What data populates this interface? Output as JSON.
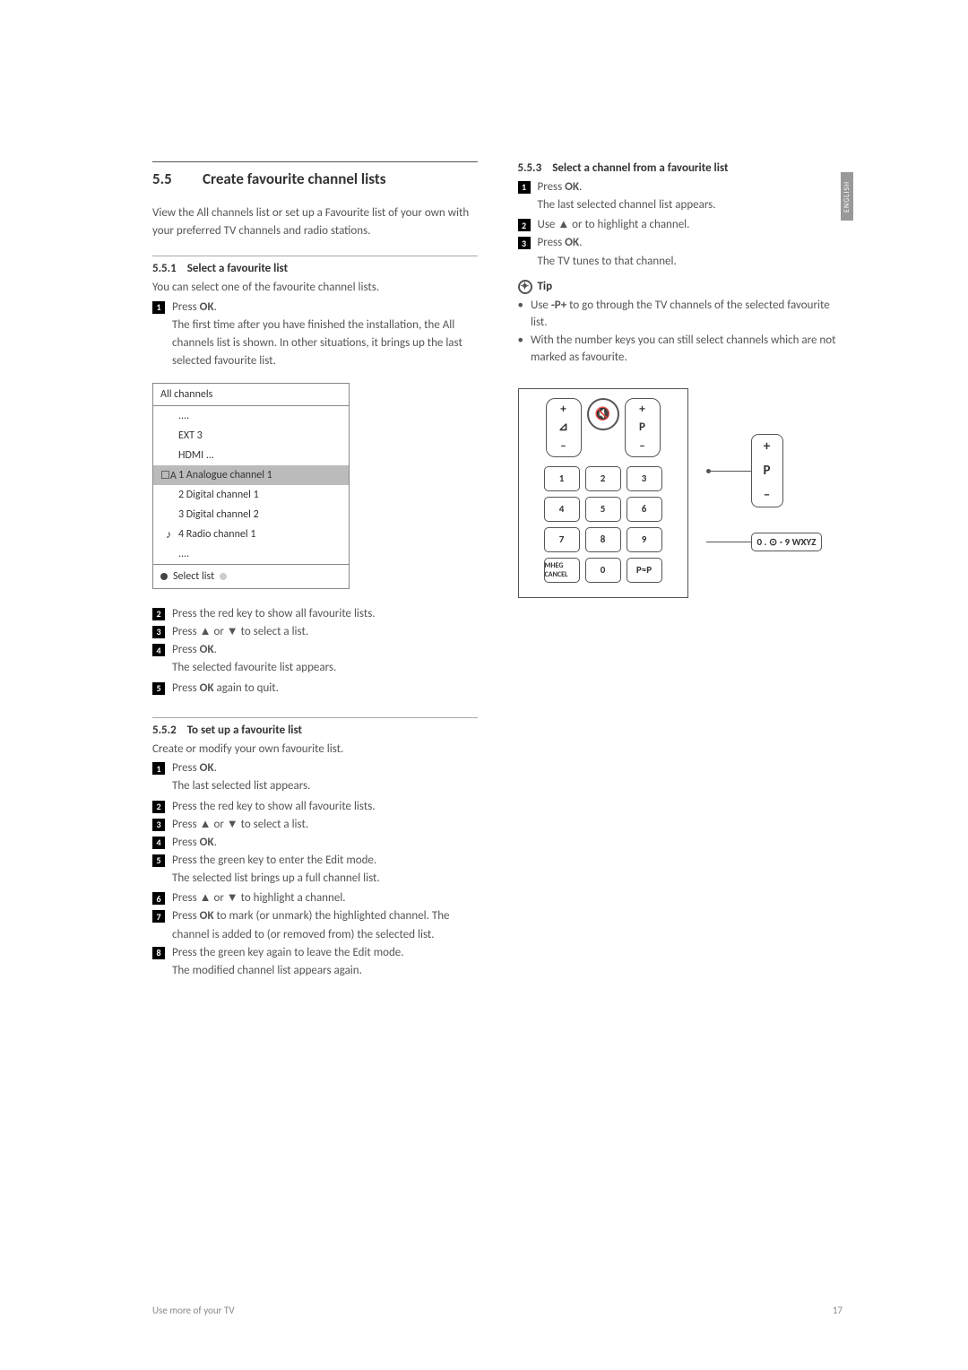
{
  "tab": "ENGLISH",
  "section": {
    "num": "5.5",
    "title": "Create favourite channel lists"
  },
  "intro": "View the All channels list or set up a Favourite list of your own with your preferred TV channels and radio stations.",
  "s551": {
    "num": "5.5.1",
    "title": "Select a favourite list",
    "lead": "You can select one of the favourite channel lists.",
    "step1": "Press OK.",
    "step1b": "The first time after you have finished the installation, the All channels list is shown. In other situations, it brings up the last selected favourite list.",
    "list": {
      "title": "All channels",
      "rows": [
        "....",
        "EXT 3",
        "HDMI ...",
        "1 Analogue channel 1",
        "2 Digital channel 1",
        "3 Digital channel 2",
        "4 Radio channel 1",
        "...."
      ],
      "footer": "Select list"
    },
    "step2": "Press the red key to show all favourite lists.",
    "step3": "Press ▲ or ▼ to select a list.",
    "step4": "Press OK.",
    "step4b": "The selected favourite list appears.",
    "step5": "Press OK again to quit."
  },
  "s552": {
    "num": "5.5.2",
    "title": "To set up a favourite list",
    "lead": "Create or modify your own favourite list.",
    "s1": "Press OK.",
    "s1b": "The last selected list appears.",
    "s2": "Press the red key to show all favourite lists.",
    "s3": "Press ▲ or ▼ to select a list.",
    "s4": "Press OK.",
    "s5": "Press the green key to enter the Edit mode.",
    "s5b": "The selected list brings up a full channel list.",
    "s6": "Press ▲ or ▼ to highlight a channel.",
    "s7": "Press OK to mark (or unmark) the highlighted channel. The channel is added to (or removed from) the selected list.",
    "s8": "Press the green key again to leave the Edit mode.",
    "s8b": "The modified channel list appears again."
  },
  "s553": {
    "num": "5.5.3",
    "title": "Select a channel from a favourite list",
    "s1": "Press OK.",
    "s1b": "The last selected channel list appears.",
    "s2": "Use ▲ or to highlight a channel.",
    "s3": "Press OK.",
    "s3b": "The TV tunes to that channel."
  },
  "tip": {
    "label": "Tip",
    "b1": "Use -P+ to go through the TV channels of the selected favourite list.",
    "b2": "With the number keys you can still select channels which are not marked as favourite."
  },
  "remote": {
    "vol": {
      "up": "+",
      "down": "–",
      "mid": "⊿"
    },
    "mute": "✕",
    "p": {
      "up": "+",
      "down": "–",
      "label": "P"
    },
    "r1": [
      "1",
      "2",
      "3"
    ],
    "r2": [
      "4",
      "5",
      "6"
    ],
    "r3": [
      "7",
      "8",
      "9"
    ],
    "r4": [
      "MHEG CANCEL",
      "0",
      "P≈P"
    ],
    "callout_num": "0 . ⊙  -  9 WXYZ"
  },
  "footer": {
    "left": "Use more of your TV",
    "right": "17"
  }
}
